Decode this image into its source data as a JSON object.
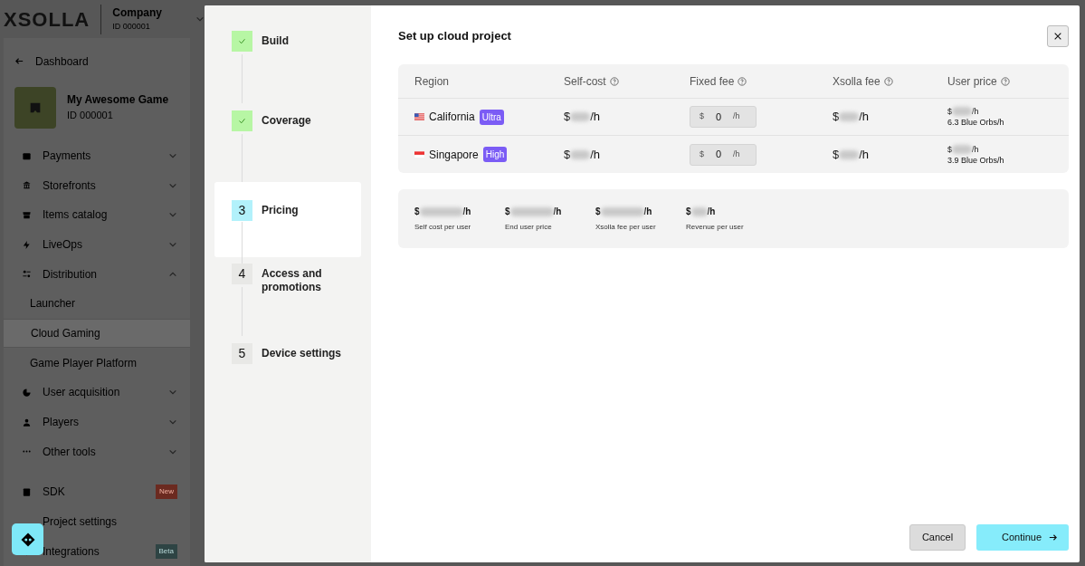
{
  "header": {
    "logo": "XSOLLA",
    "company": "Company",
    "company_id": "ID 000001"
  },
  "back_link": "Dashboard",
  "project": {
    "name": "My Awesome Game",
    "id": "ID 000001"
  },
  "nav": [
    {
      "label": "Payments",
      "kind": "wallet",
      "expanded": false
    },
    {
      "label": "Storefronts",
      "kind": "bank",
      "expanded": false
    },
    {
      "label": "Items catalog",
      "kind": "store",
      "expanded": false
    },
    {
      "label": "LiveOps",
      "kind": "bolt",
      "expanded": false
    },
    {
      "label": "Distribution",
      "kind": "sliders",
      "expanded": true,
      "children": [
        {
          "label": "Launcher",
          "selected": false
        },
        {
          "label": "Cloud Gaming",
          "selected": true
        },
        {
          "label": "Game Player Platform",
          "selected": false
        }
      ]
    },
    {
      "label": "User acquisition",
      "kind": "chart",
      "expanded": false
    },
    {
      "label": "Players",
      "kind": "person",
      "expanded": false
    },
    {
      "label": "Other tools",
      "kind": "dots",
      "expanded": false
    }
  ],
  "nav_bottom": [
    {
      "label": "SDK",
      "kind": "doc",
      "badge": "New"
    },
    {
      "label": "Project settings"
    },
    {
      "label": "Integrations",
      "kind": "globe",
      "badge": "Beta"
    }
  ],
  "steps": [
    {
      "label": "Build",
      "done": true,
      "selected": false
    },
    {
      "label": "Coverage",
      "done": true,
      "selected": false
    },
    {
      "number": "3",
      "label": "Pricing",
      "done": false,
      "selected": true
    },
    {
      "number": "4",
      "label": "Access and promotions",
      "done": false,
      "selected": false
    },
    {
      "number": "5",
      "label": "Device settings",
      "done": false,
      "selected": false
    }
  ],
  "dialog": {
    "title": "Set up cloud project"
  },
  "table": {
    "columns": [
      {
        "label": "Region",
        "help": false
      },
      {
        "label": "Self-cost",
        "help": true
      },
      {
        "label": "Fixed fee",
        "help": true
      },
      {
        "label": "Xsolla fee",
        "help": true
      },
      {
        "label": "User price",
        "help": true
      }
    ],
    "rows": [
      {
        "kind": "us",
        "region": "California",
        "tier": "Ultra",
        "self_cost": {
          "prefix": "$",
          "suffix": "/h"
        },
        "fee_currency": "$",
        "fee_value": "0",
        "fee_unit": "/h",
        "xsolla_fee": {
          "prefix": "$",
          "suffix": "/h"
        },
        "user_price": {
          "prefix": "$",
          "suffix": "/h"
        },
        "orbs": "6.3 Blue Orbs/h"
      },
      {
        "kind": "sg",
        "region": "Singapore",
        "tier": "High",
        "self_cost": {
          "prefix": "$",
          "suffix": "/h"
        },
        "fee_currency": "$",
        "fee_value": "0",
        "fee_unit": "/h",
        "xsolla_fee": {
          "prefix": "$",
          "suffix": "/h"
        },
        "user_price": {
          "prefix": "$",
          "suffix": "/h"
        },
        "orbs": "3.9 Blue Orbs/h"
      }
    ]
  },
  "summary": [
    {
      "prefix": "$",
      "suffix": "/h",
      "label": "Self cost per user",
      "kind": "wide"
    },
    {
      "prefix": "$",
      "suffix": "/h",
      "label": "End user price",
      "kind": "wide"
    },
    {
      "prefix": "$",
      "suffix": "/h",
      "label": "Xsolla fee per user",
      "kind": "wide"
    },
    {
      "prefix": "$",
      "suffix": "/h",
      "label": "Revenue per user",
      "kind": "short"
    }
  ],
  "buttons": {
    "cancel": "Cancel",
    "continue": "Continue"
  }
}
